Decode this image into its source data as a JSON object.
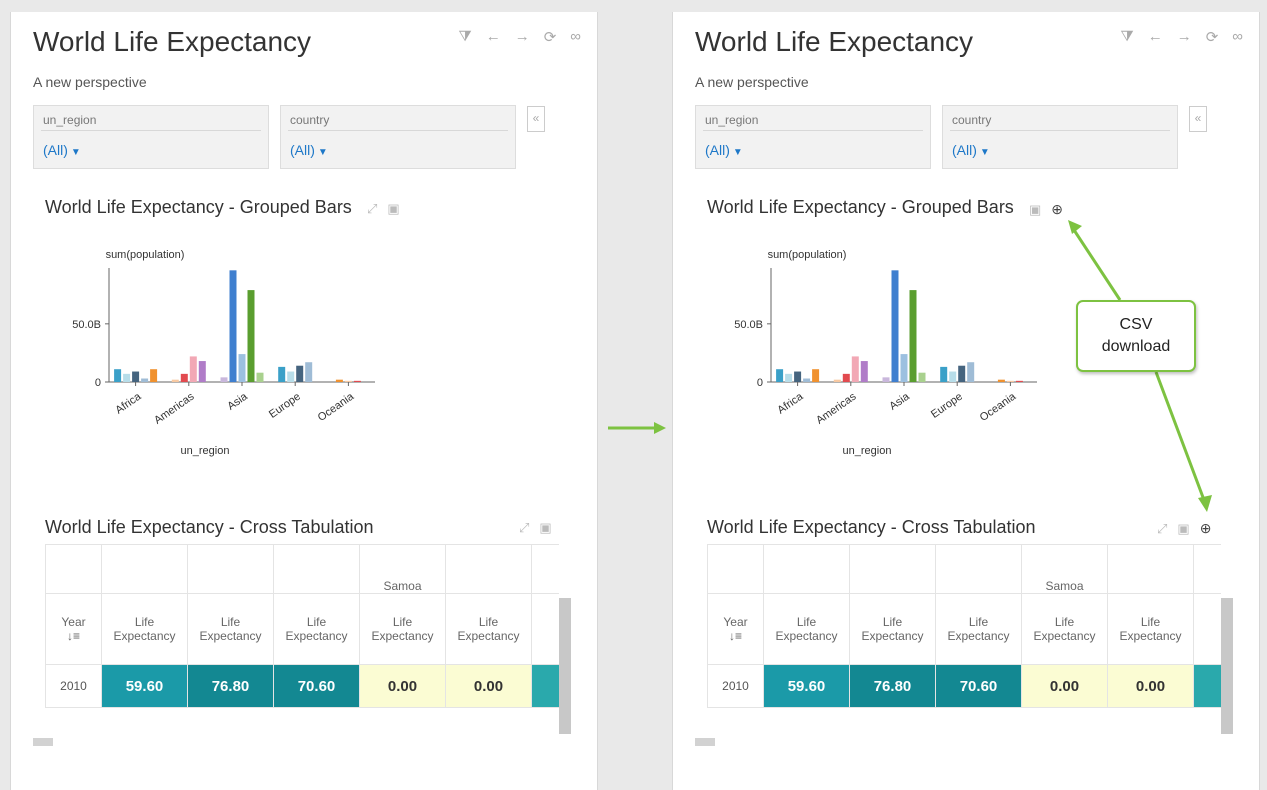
{
  "dashboard": {
    "title": "World Life Expectancy",
    "subtitle": "A new perspective",
    "toolbar_icons": [
      "filter-icon",
      "back-arrow-icon",
      "forward-arrow-icon",
      "refresh-icon",
      "link-icon"
    ]
  },
  "filters": [
    {
      "label": "un_region",
      "value": "(All)"
    },
    {
      "label": "country",
      "value": "(All)"
    }
  ],
  "collapse_glyph": "«",
  "grouped_bars": {
    "title": "World Life Expectancy - Grouped Bars",
    "icons": [
      "expand-icon",
      "image-icon"
    ],
    "download_icon": "download-icon"
  },
  "chart_data": {
    "type": "bar",
    "ylabel": "sum(population)",
    "xlabel": "un_region",
    "categories": [
      "Africa",
      "Americas",
      "Asia",
      "Europe",
      "Oceania"
    ],
    "ytick_labels": [
      "0",
      "50.0B"
    ],
    "ytick_values": [
      0,
      50
    ],
    "ylim": [
      0,
      98
    ],
    "y_unit": "B",
    "legend": "none",
    "bar_colors": [
      "#3aa0c8",
      "#b7dde9",
      "#45647f",
      "#9fbcd6",
      "#f0912e",
      "#f8c9a2",
      "#e24a4f",
      "#f2a8b5",
      "#b07cc8",
      "#c9b7dc",
      "#3f7fcf",
      "#9cc0e0",
      "#5a9e2f",
      "#a9d18e"
    ],
    "groups": [
      {
        "category": "Africa",
        "values": [
          11,
          7,
          9,
          3,
          11
        ]
      },
      {
        "category": "Americas",
        "values": [
          2,
          7,
          22,
          18
        ]
      },
      {
        "category": "Asia",
        "values": [
          4,
          96,
          24,
          79,
          8
        ]
      },
      {
        "category": "Europe",
        "values": [
          13,
          9,
          14,
          17
        ]
      },
      {
        "category": "Oceania",
        "values": [
          2,
          1,
          1
        ]
      }
    ]
  },
  "cross_tab": {
    "title": "World Life Expectancy - Cross Tabulation",
    "icons": [
      "expand-icon",
      "image-icon"
    ],
    "download_icon": "download-icon",
    "top_row": [
      "",
      "",
      "",
      "",
      "Samoa",
      "",
      ""
    ],
    "header_row": [
      "Year",
      "Life Expectancy",
      "Life Expectancy",
      "Life Expectancy",
      "Life Expectancy",
      "Life Expectancy",
      "Ex"
    ],
    "sort_glyph": "↓≡",
    "data_row": [
      "2010",
      "59.60",
      "76.80",
      "70.60",
      "0.00",
      "0.00",
      ""
    ]
  },
  "annotation": {
    "line1": "CSV",
    "line2": "download",
    "color": "#7dc241"
  }
}
